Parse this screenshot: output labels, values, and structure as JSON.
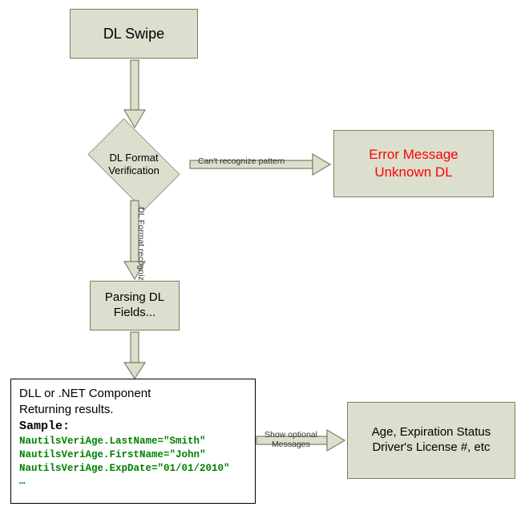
{
  "chart_data": {
    "type": "flowchart",
    "nodes": [
      {
        "id": "swipe",
        "label": "DL Swipe"
      },
      {
        "id": "verify",
        "label": "DL Format Verification"
      },
      {
        "id": "error",
        "label": "Error Message\nUnknown DL"
      },
      {
        "id": "parse",
        "label": "Parsing DL Fields..."
      },
      {
        "id": "result",
        "label": "DLL or .NET Component Returning results."
      },
      {
        "id": "output",
        "label": "Age, Expiration Status Driver's License  #, etc"
      }
    ],
    "edges": [
      {
        "from": "swipe",
        "to": "verify",
        "label": ""
      },
      {
        "from": "verify",
        "to": "error",
        "label": "Can't recognize pattern"
      },
      {
        "from": "verify",
        "to": "parse",
        "label": "DL Format recognized"
      },
      {
        "from": "parse",
        "to": "result",
        "label": ""
      },
      {
        "from": "result",
        "to": "output",
        "label": "Show optional Messages"
      }
    ]
  },
  "swipe": {
    "label": "DL Swipe"
  },
  "verify": {
    "label": "DL Format\nVerification"
  },
  "error": {
    "line1": "Error Message",
    "line2": "Unknown DL"
  },
  "parse": {
    "label": "Parsing DL\nFields..."
  },
  "result": {
    "title1": "DLL or .NET Component",
    "title2": "Returning results.",
    "sample_label": "Sample:",
    "line1": "NautilsVeriAge.LastName=\"Smith\"",
    "line2": "NautilsVeriAge.FirstName=\"John\"",
    "line3": "NautilsVeriAge.ExpDate=\"01/01/2010\"",
    "line4": "…"
  },
  "output": {
    "line1": "Age, Expiration Status",
    "line2": "Driver's License  #, etc"
  },
  "edge": {
    "verify_error": "Can't recognize pattern",
    "verify_parse": "DL Format\nrecognized",
    "result_output_1": "Show optional",
    "result_output_2": "Messages"
  },
  "colors": {
    "box_fill": "#DCDFCD",
    "box_stroke": "#7A7F63",
    "error_text": "#ff0000",
    "sample_text": "#008000"
  }
}
